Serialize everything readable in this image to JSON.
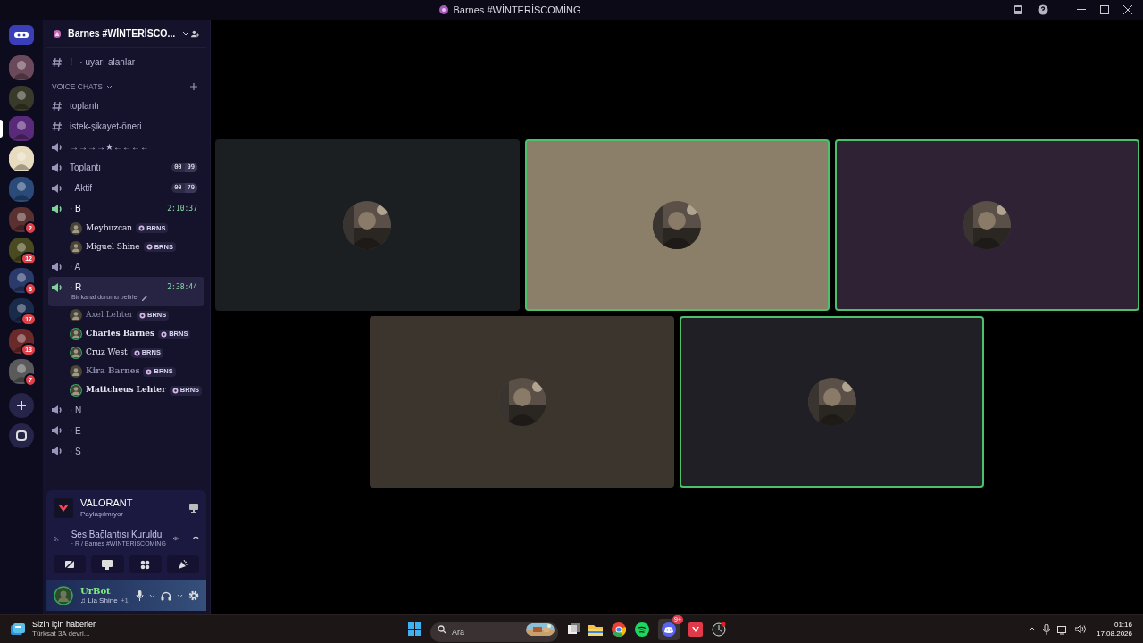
{
  "title_bar": {
    "title": "Barnes #WİNTERİSCOMİNG"
  },
  "server_rail": {
    "servers": [
      {
        "selected": false
      },
      {
        "selected": false
      },
      {
        "selected": true
      },
      {
        "selected": false
      },
      {
        "selected": false
      },
      {
        "selected": false,
        "badge": "2"
      },
      {
        "selected": false,
        "badge": "12"
      },
      {
        "selected": false,
        "badge": "8"
      },
      {
        "selected": false,
        "badge": "17"
      },
      {
        "selected": false,
        "badge": "13"
      },
      {
        "selected": false,
        "badge": "7"
      }
    ]
  },
  "server_header": {
    "name": "Barnes #WİNTERİSCO..."
  },
  "channels": [
    {
      "kind": "text",
      "alert": "!",
      "name": "· uyarı-alanlar",
      "selected": false
    },
    {
      "kind": "category",
      "name": "VOICE CHATS"
    },
    {
      "kind": "text",
      "name": "toplantı",
      "selected": false
    },
    {
      "kind": "text",
      "name": "istek-şikayet-öneri",
      "selected": false
    },
    {
      "kind": "voice",
      "name": "→→→→★←←←←",
      "active": false,
      "selected": false
    },
    {
      "kind": "voice",
      "name": "Toplantı",
      "counts": [
        "00",
        "99"
      ],
      "active": false,
      "selected": false
    },
    {
      "kind": "voice",
      "name": "· Aktif",
      "counts": [
        "00",
        "79"
      ],
      "active": false,
      "selected": false
    },
    {
      "kind": "voice",
      "name": "· B",
      "time": "2:10:37",
      "active": true,
      "selected": false,
      "users": [
        {
          "name": "Meybuzcan",
          "tag": "BRNS",
          "speaking": false,
          "bold": false,
          "dim": false
        },
        {
          "name": "Miguel Shine",
          "tag": "BRNS",
          "speaking": false,
          "bold": false,
          "dim": false
        }
      ]
    },
    {
      "kind": "voice",
      "name": "· A",
      "active": false,
      "selected": false
    },
    {
      "kind": "voice",
      "name": "· R",
      "time": "2:38:44",
      "status": "Bir kanal durumu belirle",
      "active": true,
      "selected": true,
      "users": [
        {
          "name": "Axel Lehter",
          "tag": "BRNS",
          "speaking": false,
          "bold": false,
          "dim": true
        },
        {
          "name": "Charles Barnes",
          "tag": "BRNS",
          "speaking": true,
          "bold": true,
          "dim": false
        },
        {
          "name": "Cruz West",
          "tag": "BRNS",
          "speaking": true,
          "bold": false,
          "dim": false
        },
        {
          "name": "Kira Barnes",
          "tag": "BRNS",
          "speaking": false,
          "bold": true,
          "dim": true
        },
        {
          "name": "Mattcheus Lehter",
          "tag": "BRNS",
          "speaking": true,
          "bold": true,
          "dim": false
        }
      ]
    },
    {
      "kind": "voice",
      "name": "· N",
      "active": false,
      "selected": false
    },
    {
      "kind": "voice",
      "name": "· E",
      "active": false,
      "selected": false
    },
    {
      "kind": "voice",
      "name": "· S",
      "active": false,
      "selected": false
    }
  ],
  "activity": {
    "game": "VALORANT",
    "status": "Paylaşılmıyor"
  },
  "voice_connection": {
    "title": "Ses Bağlantısı Kuruldu",
    "location": "· R / Barnes #WİNTERİSCOMİNG"
  },
  "user_panel": {
    "name": "UrBot",
    "activity": "♫ Lia Shine",
    "extra": "+1"
  },
  "video_tiles": [
    {
      "color": "#1b1f21",
      "speaking": false
    },
    {
      "color": "#8b7f69",
      "speaking": true
    },
    {
      "color": "#2e2234",
      "speaking": true
    },
    {
      "color": "#3b352e",
      "speaking": false
    },
    {
      "color": "#1f1f25",
      "speaking": true
    }
  ],
  "taskbar": {
    "news_title": "Sizin için haberler",
    "news_text": "Türksat 3A devri...",
    "search_placeholder": "Ara",
    "discord_badge": "9+",
    "time": "01:16",
    "date": "17.08.2026"
  }
}
